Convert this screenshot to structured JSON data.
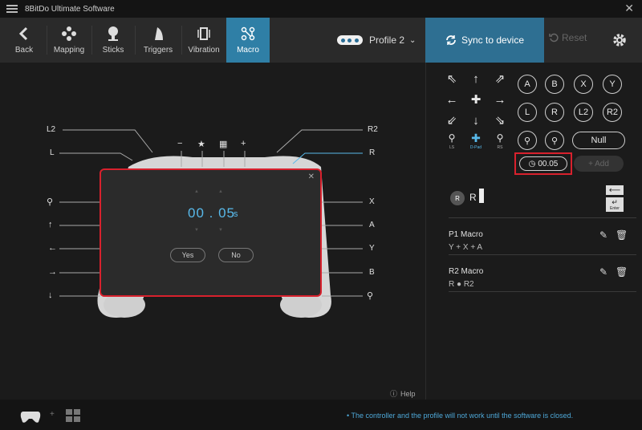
{
  "app": {
    "title": "8BitDo Ultimate Software"
  },
  "toolbar": {
    "back": "Back",
    "mapping": "Mapping",
    "sticks": "Sticks",
    "triggers": "Triggers",
    "vibration": "Vibration",
    "macro": "Macro",
    "profile": "Profile 2",
    "sync": "Sync to device",
    "reset": "Reset"
  },
  "controller_labels": {
    "left": [
      "L2",
      "L",
      "X",
      "A",
      "Y",
      "B"
    ],
    "l2": "L2",
    "l": "L",
    "r2": "R2",
    "r": "R",
    "x": "X",
    "a": "A",
    "y": "Y",
    "b": "B",
    "minus": "−",
    "star": "★",
    "plus": "+"
  },
  "dialog": {
    "time": "00 . 05",
    "unit": "s",
    "yes": "Yes",
    "no": "No"
  },
  "buttons": {
    "a": "A",
    "b": "B",
    "x": "X",
    "y": "Y",
    "l": "L",
    "r": "R",
    "l2": "L2",
    "r2": "R2",
    "null": "Null",
    "timer": "00.05",
    "add": "+ Add",
    "ls": "LS",
    "dpad": "D-Pad",
    "rs": "RS"
  },
  "current_macro": {
    "badge": "R",
    "text": "R"
  },
  "enter_label": "Enter",
  "macros": [
    {
      "title": "P1 Macro",
      "sequence": "Y + X + A"
    },
    {
      "title": "R2 Macro",
      "sequence": "R ● R2"
    }
  ],
  "help": "Help",
  "notice": "• The controller and the profile will not work until the software is closed."
}
